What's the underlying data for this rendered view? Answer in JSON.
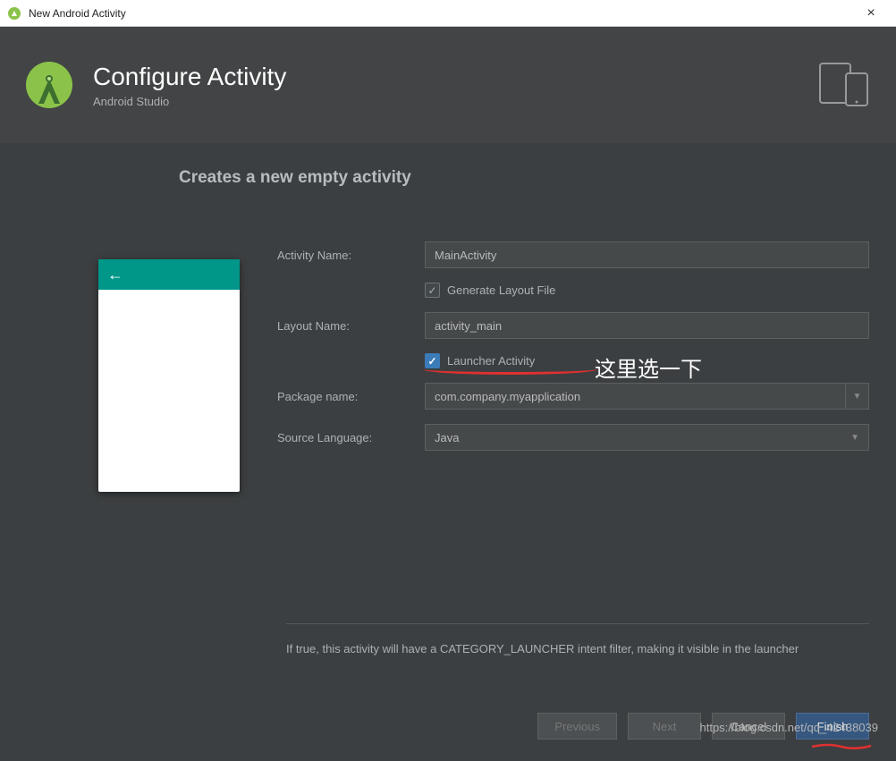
{
  "window": {
    "title": "New Android Activity"
  },
  "header": {
    "title": "Configure Activity",
    "subtitle": "Android Studio"
  },
  "section": {
    "title": "Creates a new empty activity"
  },
  "form": {
    "activityName": {
      "label": "Activity Name:",
      "value": "MainActivity"
    },
    "generateLayout": {
      "label": "Generate Layout File",
      "checked": true
    },
    "layoutName": {
      "label": "Layout Name:",
      "value": "activity_main"
    },
    "launcherActivity": {
      "label": "Launcher Activity",
      "checked": true
    },
    "packageName": {
      "label": "Package name:",
      "value": "com.company.myapplication"
    },
    "sourceLanguage": {
      "label": "Source Language:",
      "value": "Java"
    }
  },
  "annotation": {
    "text": "这里选一下"
  },
  "help": {
    "text": "If true, this activity will have a CATEGORY_LAUNCHER intent filter, making it visible in the launcher"
  },
  "buttons": {
    "previous": "Previous",
    "next": "Next",
    "cancel": "Cancel",
    "finish": "Finish"
  },
  "watermark": "https://blog.csdn.net/qq_42438039"
}
